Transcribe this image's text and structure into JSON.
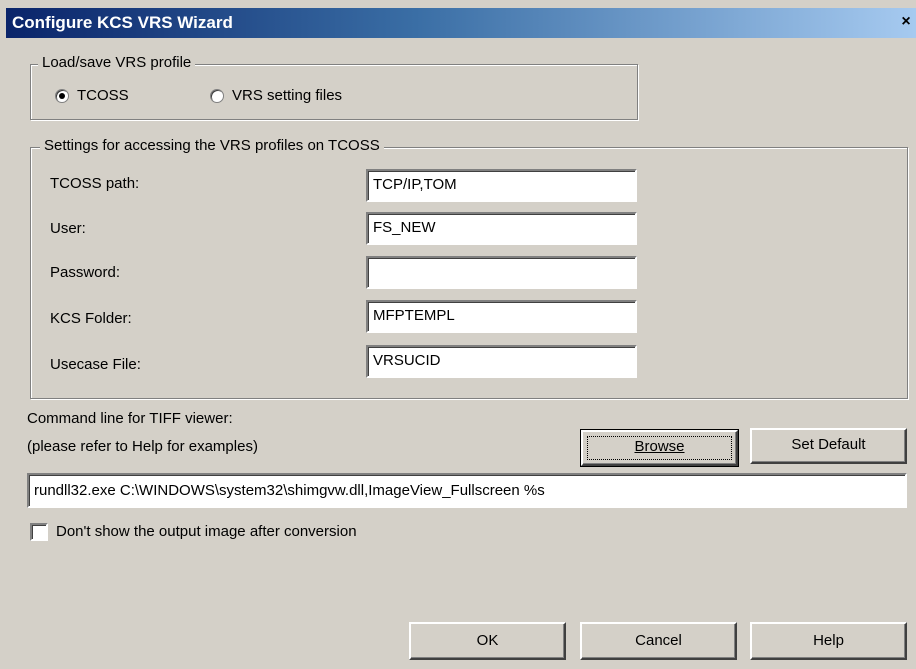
{
  "window": {
    "title": "Configure KCS VRS Wizard",
    "close_glyph": "×"
  },
  "profile_group": {
    "legend": "Load/save VRS profile",
    "options": [
      {
        "label": "TCOSS",
        "selected": true
      },
      {
        "label": "VRS setting files",
        "selected": false
      }
    ]
  },
  "settings_group": {
    "legend": "Settings for accessing the VRS profiles on TCOSS",
    "fields": [
      {
        "label": "TCOSS path:",
        "value": "TCP/IP,TOM"
      },
      {
        "label": "User:",
        "value": "FS_NEW"
      },
      {
        "label": "Password:",
        "value": ""
      },
      {
        "label": "KCS Folder:",
        "value": "MFPTEMPL"
      },
      {
        "label": "Usecase File:",
        "value": "VRSUCID"
      }
    ]
  },
  "viewer": {
    "label": "Command line for TIFF viewer:",
    "hint": "(please refer to Help for examples)",
    "browse_label": "Browse",
    "set_default_label": "Set Default",
    "command_value": "rundll32.exe C:\\WINDOWS\\system32\\shimgvw.dll,ImageView_Fullscreen %s"
  },
  "checkbox": {
    "label": "Don't show the output image after conversion",
    "checked": false
  },
  "footer": {
    "ok_label": "OK",
    "cancel_label": "Cancel",
    "help_label": "Help"
  }
}
